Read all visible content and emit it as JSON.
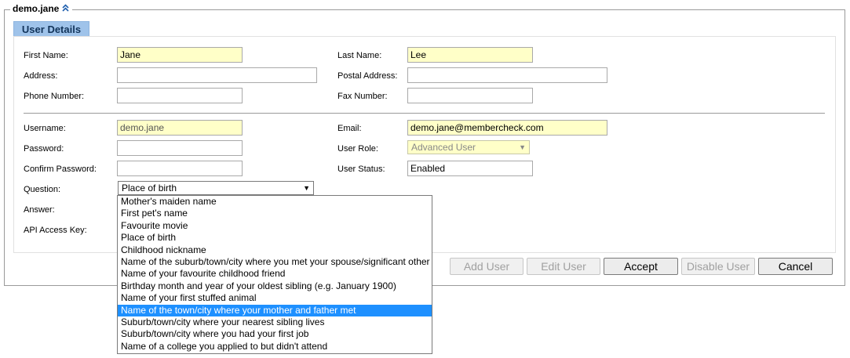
{
  "header": {
    "title": "demo.jane",
    "collapse_icon": "double-chevron-up-icon"
  },
  "tab": {
    "label": "User Details"
  },
  "fields": {
    "first_name": {
      "label": "First Name:",
      "value": "Jane"
    },
    "last_name": {
      "label": "Last Name:",
      "value": "Lee"
    },
    "address": {
      "label": "Address:",
      "value": ""
    },
    "postal_address": {
      "label": "Postal Address:",
      "value": ""
    },
    "phone": {
      "label": "Phone Number:",
      "value": ""
    },
    "fax": {
      "label": "Fax Number:",
      "value": ""
    },
    "username": {
      "label": "Username:",
      "value": "demo.jane"
    },
    "email": {
      "label": "Email:",
      "value": "demo.jane@membercheck.com"
    },
    "password": {
      "label": "Password:",
      "value": ""
    },
    "user_role": {
      "label": "User Role:",
      "value": "Advanced User"
    },
    "confirm_password": {
      "label": "Confirm Password:",
      "value": ""
    },
    "user_status": {
      "label": "User Status:",
      "value": "Enabled"
    },
    "question": {
      "label": "Question:",
      "value": "Place of birth"
    },
    "answer": {
      "label": "Answer:"
    },
    "api_key": {
      "label": "API Access Key:"
    }
  },
  "question_options": [
    "Mother's maiden name",
    "First pet's name",
    "Favourite movie",
    "Place of birth",
    "Childhood nickname",
    "Name of the suburb/town/city where you met your spouse/significant other",
    "Name of your favourite childhood friend",
    "Birthday month and year of your oldest sibling (e.g. January 1900)",
    "Name of your first stuffed animal",
    "Name of the town/city where your mother and father met",
    "Suburb/town/city where your nearest sibling lives",
    "Suburb/town/city where you had your first job",
    "Name of a college you applied to but didn't attend"
  ],
  "highlighted_option_index": 9,
  "buttons": {
    "add_user": "Add User",
    "edit_user": "Edit User",
    "accept": "Accept",
    "disable_user": "Disable User",
    "cancel": "Cancel"
  },
  "colors": {
    "required_field": "#ffffc8",
    "tab_bg": "#9fc3ea",
    "highlight": "#1e90ff"
  }
}
